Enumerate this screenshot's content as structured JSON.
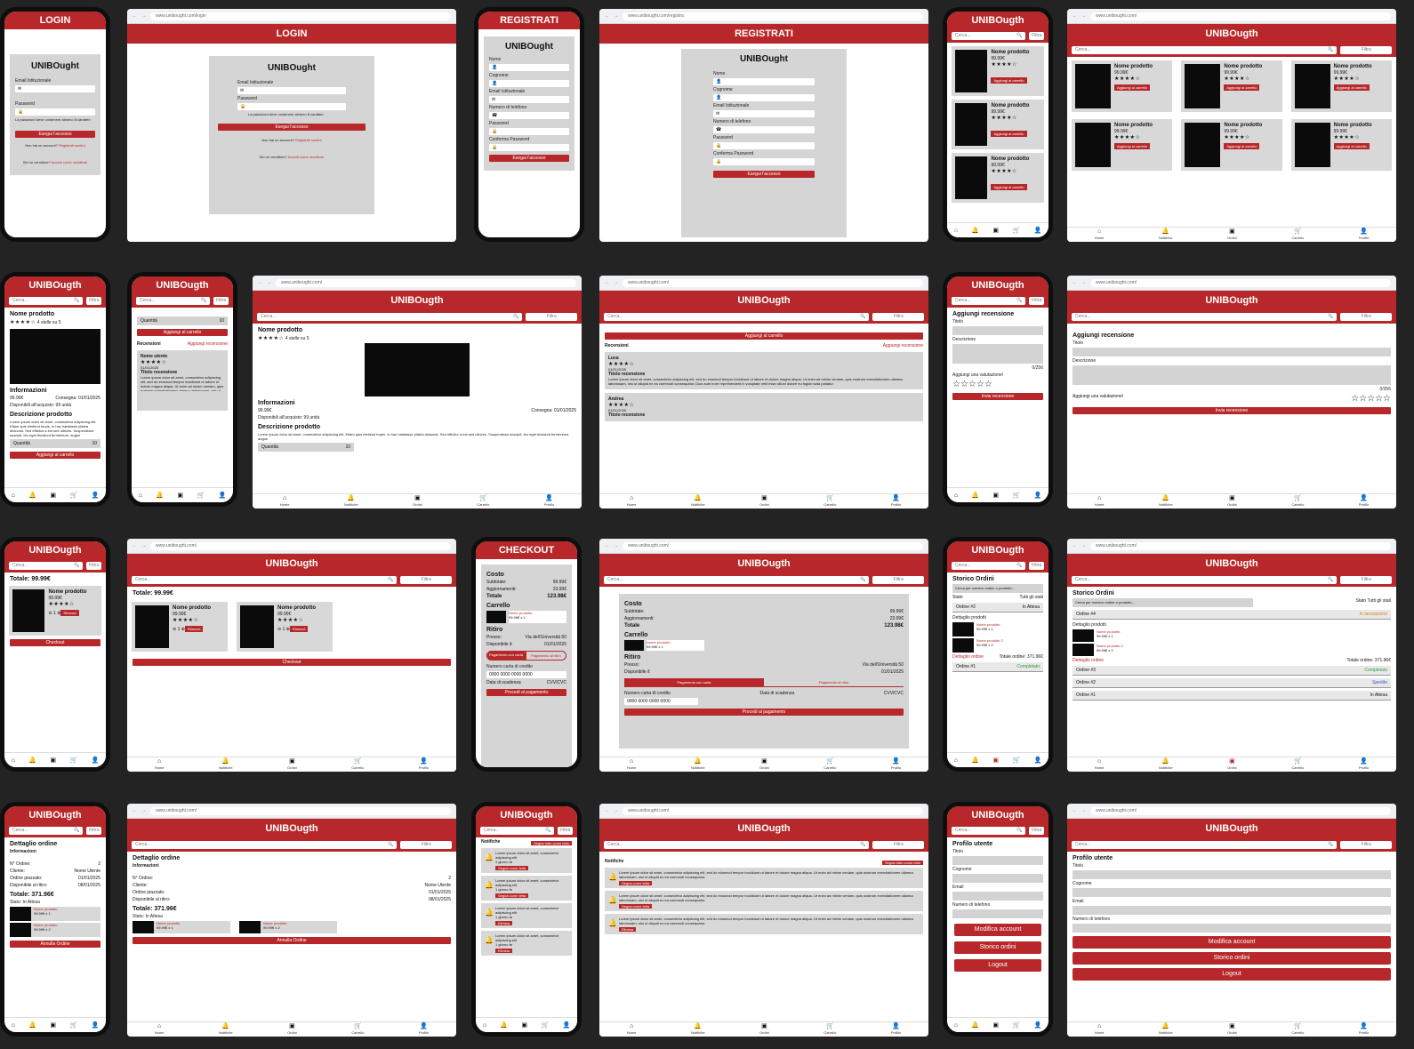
{
  "app_name": "UNIBOught",
  "app_brand_header": "UNIBOugth",
  "url_login": "www.unibought.com/login",
  "url_register": "www.unibought.com/registra",
  "url_home": "www.unibought.com/",
  "login": {
    "title": "LOGIN",
    "email_label": "Email Istituzionale",
    "password_label": "Password",
    "hint": "La password deve contenere almeno 8 caratteri",
    "submit": "Esegui l'accesso",
    "no_account": "Non hai un account?",
    "register_link": "Registrati subito!",
    "seller": "Sei un venditore?",
    "seller_link": "Accedi come venditore"
  },
  "register": {
    "title": "REGISTRATI",
    "fields": [
      "Nome",
      "Cognome",
      "Email Istituzionale",
      "Numero di telefono",
      "Password",
      "Conferma Password"
    ],
    "submit": "Esegui l'accesso"
  },
  "search": {
    "placeholder": "Cerca...",
    "filter": "Filtra"
  },
  "product": {
    "name": "Nome prodotto",
    "price": "99.99€",
    "stars": "★★★★☆",
    "stars_text": "4 stelle su 5",
    "add_to_cart": "Aggiungi al carrello",
    "info_title": "Informazioni",
    "delivery": "Consegna: 01/01/2025",
    "available": "Disponibili all'acquisto: 99 unità",
    "desc_title": "Descrizione prodotto",
    "desc": "Lorem ipsum dolor sit amet, consectetur adipiscing elit. Etiam quis eleifend turpis. In hac habitasse platea dictumst. Sed efficitur a est sed ultrices. Suspendisse suscipit, leo eget tincidunt fermentum, augue",
    "quantity": "Quantità",
    "quantity_val": "10"
  },
  "reviews": {
    "title": "Recensioni",
    "add_link": "Aggiungi recensione",
    "user": "Nome utente",
    "user1": "Luca",
    "user2": "Andrea",
    "date": "01/01/2025",
    "review_title": "Titolo recensione",
    "text": "Lorem ipsum dolor sit amet, consectetur adipiscing elit, sed do eiusmod tempor incididunt ut labore et dolore magna aliqua. Ut enim ad minim veniam, quis nostrum exercitationem ullamco laboriosam, nisi ut aliquid ex ea commodi consequatur. Duis aute irure reprehenderit in voluptate velit esse cillum dolore eu fugiat nulla pariatur."
  },
  "add_review": {
    "title": "Aggiungi recensione",
    "title_label": "Titolo",
    "desc_label": "Descrizione",
    "counter": "0/256",
    "rating_label": "Aggiungi una valutazione!",
    "empty_stars": "☆☆☆☆☆",
    "submit": "Invia recensione"
  },
  "cart": {
    "total": "Totale: 99.99€",
    "qty": "1",
    "remove": "Rimuovi",
    "checkout": "Checkout"
  },
  "checkout": {
    "title": "CHECKOUT",
    "cost": "Costo",
    "subtotal_label": "Subtotale:",
    "subtotal": "99.99€",
    "shipping_label": "Aggiornamenti:",
    "shipping": "23.99€",
    "total_label": "Totale",
    "total": "123.98€",
    "cart_label": "Carrello",
    "cart_item": "Nome prodotto",
    "cart_item_price": "99.99€ x 1",
    "pickup": "Ritiro",
    "pickup_at": "Presso:",
    "pickup_place": "Via dell'Università 50",
    "available_on": "Disponibile il:",
    "available_date": "01/01/2025",
    "pay_card": "Pagamento con carta",
    "pay_pickup": "Pagamento al ritiro",
    "card_number": "Numero carta di credito",
    "card_placeholder": "0000 0000 0000 0000",
    "expiry": "Data di scadenza",
    "cvv": "CVV/CVC",
    "submit": "Procedi al pagamento"
  },
  "orders": {
    "title": "Storico Ordini",
    "search": "Cerca per numero ordine o prodotto...",
    "status_label": "Stato",
    "status_val": "Tutti gli stati",
    "list": [
      {
        "name": "Ordine #4",
        "status": "In lavorazione"
      },
      {
        "name": "Ordine #3",
        "status": "Completato"
      },
      {
        "name": "Ordine #2",
        "status": "Spedito"
      },
      {
        "name": "Ordine #1",
        "status": "In Attesa"
      }
    ],
    "m_list": [
      {
        "name": "Ordine #2",
        "status": "In Attesa"
      },
      {
        "name": "Ordine #1",
        "status": "Completato"
      }
    ],
    "detail_products": "Dettaglio prodotti",
    "item1": "Nome prodotto",
    "item1_price": "99.99€ x 1",
    "item2": "Nome prodotto 2",
    "item2_price": "99.99€ x 2",
    "detail_link": "Dettaglio ordine",
    "order_total": "Totale ordine: 371.96€"
  },
  "order_detail": {
    "title": "Dettaglio ordine",
    "info": "Informazioni",
    "n_label": "N° Ordine:",
    "n": "2",
    "client_label": "Cliente:",
    "client": "Nome Utente",
    "placed_label": "Ordine piazzato:",
    "placed": "01/01/2025",
    "available_label": "Disponibile al ritiro:",
    "available": "08/01/2025",
    "total": "Totale: 371.96€",
    "status": "Stato: In Attesa",
    "cancel": "Annulla Ordine"
  },
  "notifications": {
    "title": "Notifiche",
    "mark_all": "Segna tutto come letto",
    "text": "Lorem ipsum dolor sit amet, consectetur adipiscing elit, sed do eiusmod tempor incididunt ut labore et dolore magna aliqua. Ut enim ad minim veniam, quis nostrum exercitationem ullamco laboriosam, nisi ut aliquid ex ea commodi consequatur.",
    "short": "Lorem ipsum dolor sit amet, consectetur adipiscing elit",
    "mark_read": "Segna come letta",
    "delete": "Elimina",
    "time": "1 giorno fa"
  },
  "profile": {
    "title": "Profilo utente",
    "fields": [
      "Titolo",
      "Cognome",
      "Email",
      "Numero di telefono"
    ],
    "edit": "Modifica account",
    "orders": "Storico ordini",
    "logout": "Logout"
  },
  "nav": {
    "home": "Home",
    "notif": "Notifiche",
    "orders": "Ordini",
    "cart": "Carrello",
    "profile": "Profilo"
  },
  "colors": {
    "brand": "#b8282a",
    "panel": "#d5d5d5",
    "background": "#232323"
  }
}
